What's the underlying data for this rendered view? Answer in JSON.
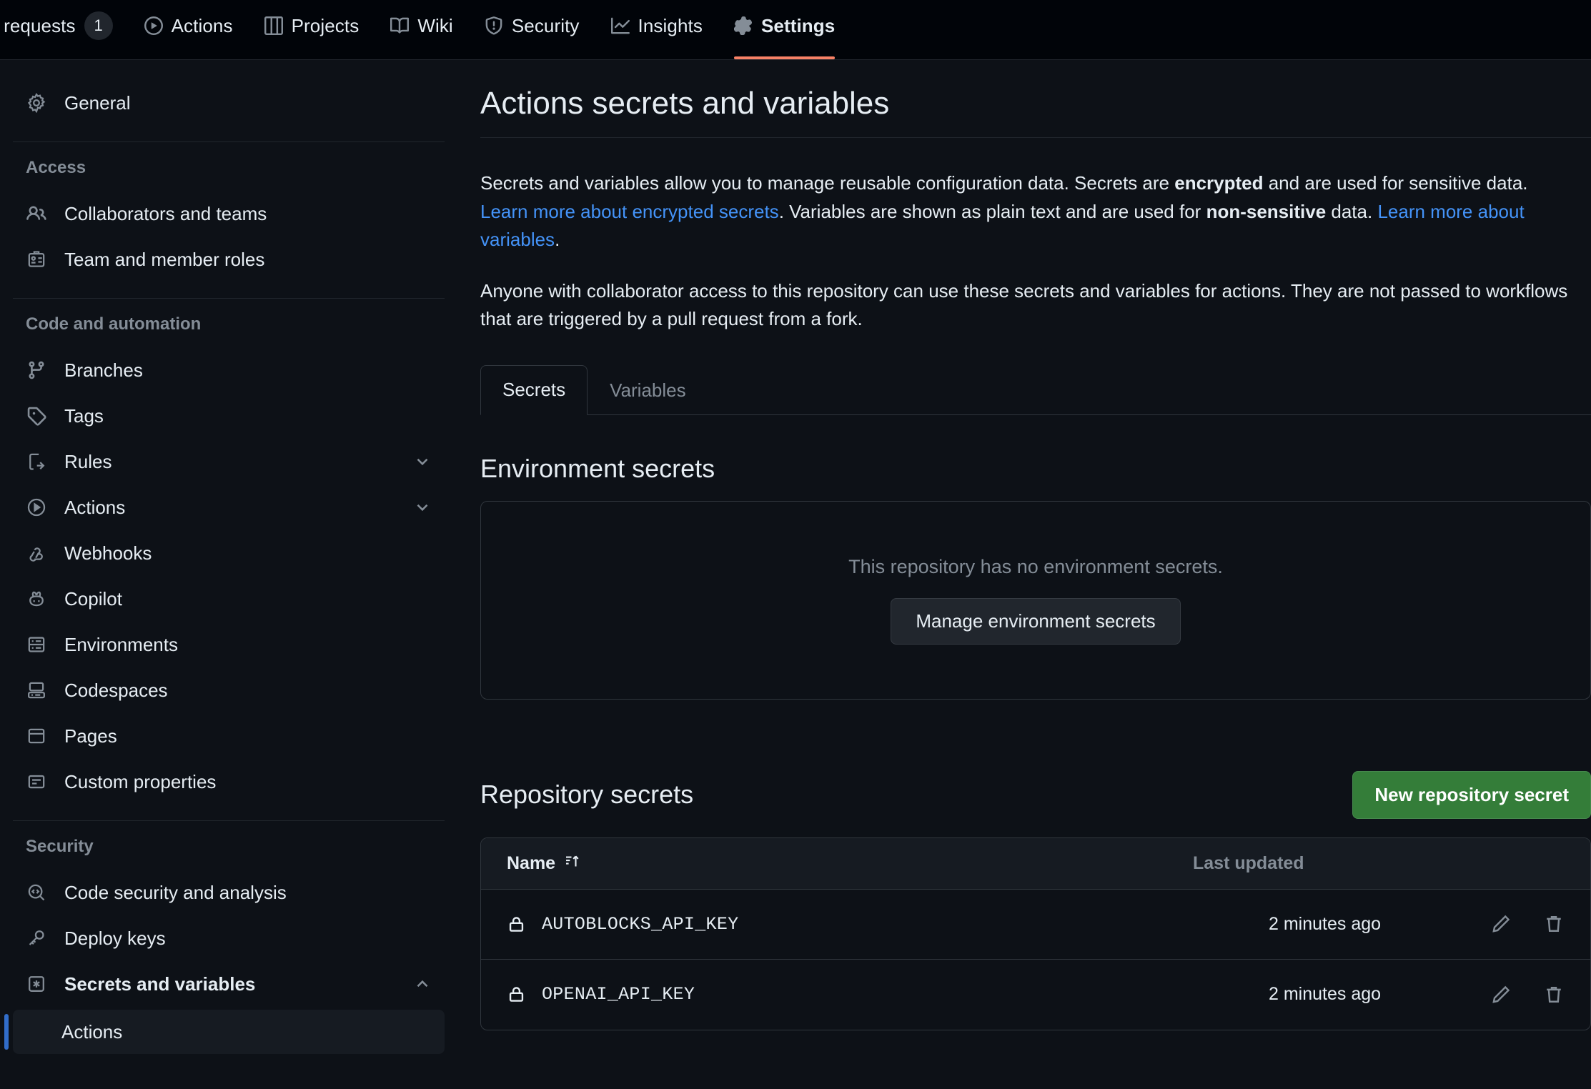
{
  "repo_nav": {
    "items": [
      {
        "label": "ll requests",
        "icon": "",
        "badge": "1",
        "active": false
      },
      {
        "label": "Actions",
        "icon": "play-icon",
        "badge": "",
        "active": false
      },
      {
        "label": "Projects",
        "icon": "table-icon",
        "badge": "",
        "active": false
      },
      {
        "label": "Wiki",
        "icon": "book-icon",
        "badge": "",
        "active": false
      },
      {
        "label": "Security",
        "icon": "shield-icon",
        "badge": "",
        "active": false
      },
      {
        "label": "Insights",
        "icon": "graph-icon",
        "badge": "",
        "active": false
      },
      {
        "label": "Settings",
        "icon": "gear-icon",
        "badge": "",
        "active": true
      }
    ],
    "active_underline_color": "#f78166"
  },
  "sidebar": {
    "general": {
      "label": "General",
      "icon": "gear-icon"
    },
    "groups": [
      {
        "title": "Access",
        "items": [
          {
            "label": "Collaborators and teams",
            "icon": "people-icon",
            "expandable": false
          },
          {
            "label": "Team and member roles",
            "icon": "id-badge-icon",
            "expandable": false
          }
        ]
      },
      {
        "title": "Code and automation",
        "items": [
          {
            "label": "Branches",
            "icon": "git-branch-icon",
            "expandable": false
          },
          {
            "label": "Tags",
            "icon": "tag-icon",
            "expandable": false
          },
          {
            "label": "Rules",
            "icon": "rules-icon",
            "expandable": true
          },
          {
            "label": "Actions",
            "icon": "play-icon",
            "expandable": true
          },
          {
            "label": "Webhooks",
            "icon": "webhook-icon",
            "expandable": false
          },
          {
            "label": "Copilot",
            "icon": "copilot-icon",
            "expandable": false
          },
          {
            "label": "Environments",
            "icon": "server-icon",
            "expandable": false
          },
          {
            "label": "Codespaces",
            "icon": "codespaces-icon",
            "expandable": false
          },
          {
            "label": "Pages",
            "icon": "browser-icon",
            "expandable": false
          },
          {
            "label": "Custom properties",
            "icon": "properties-icon",
            "expandable": false
          }
        ]
      },
      {
        "title": "Security",
        "items": [
          {
            "label": "Code security and analysis",
            "icon": "code-search-icon",
            "expandable": false
          },
          {
            "label": "Deploy keys",
            "icon": "key-icon",
            "expandable": false
          }
        ]
      }
    ],
    "secrets_and_variables": {
      "label": "Secrets and variables",
      "icon": "asterisk-square-icon",
      "expanded": true,
      "sub_items": [
        {
          "label": "Actions",
          "selected": true
        }
      ]
    }
  },
  "main": {
    "page_title": "Actions secrets and variables",
    "paragraph1": {
      "part1": "Secrets and variables allow you to manage reusable configuration data. Secrets are ",
      "bold1": "encrypted",
      "part2": " and are used for sensitive data. ",
      "link1": "Learn more about encrypted secrets",
      "part3": ". Variables are shown as plain text and are used for ",
      "bold2": "non-sensitive",
      "part4": " data. ",
      "link2": "Learn more about variables",
      "part5": "."
    },
    "paragraph2": "Anyone with collaborator access to this repository can use these secrets and variables for actions. They are not passed to workflows that are triggered by a pull request from a fork.",
    "tabs": [
      {
        "label": "Secrets",
        "active": true
      },
      {
        "label": "Variables",
        "active": false
      }
    ],
    "environment_secrets": {
      "title": "Environment secrets",
      "empty_text": "This repository has no environment secrets.",
      "manage_button": "Manage environment secrets"
    },
    "repository_secrets": {
      "title": "Repository secrets",
      "new_button": "New repository secret",
      "new_button_color": "#347d39",
      "columns": {
        "name": "Name",
        "sort_icon": "sort-asc-icon",
        "last_updated": "Last updated"
      },
      "rows": [
        {
          "icon": "lock-icon",
          "name": "AUTOBLOCKS_API_KEY",
          "last_updated": "2 minutes ago",
          "edit_icon": "pencil-icon",
          "delete_icon": "trash-icon"
        },
        {
          "icon": "lock-icon",
          "name": "OPENAI_API_KEY",
          "last_updated": "2 minutes ago",
          "edit_icon": "pencil-icon",
          "delete_icon": "trash-icon"
        }
      ]
    }
  }
}
